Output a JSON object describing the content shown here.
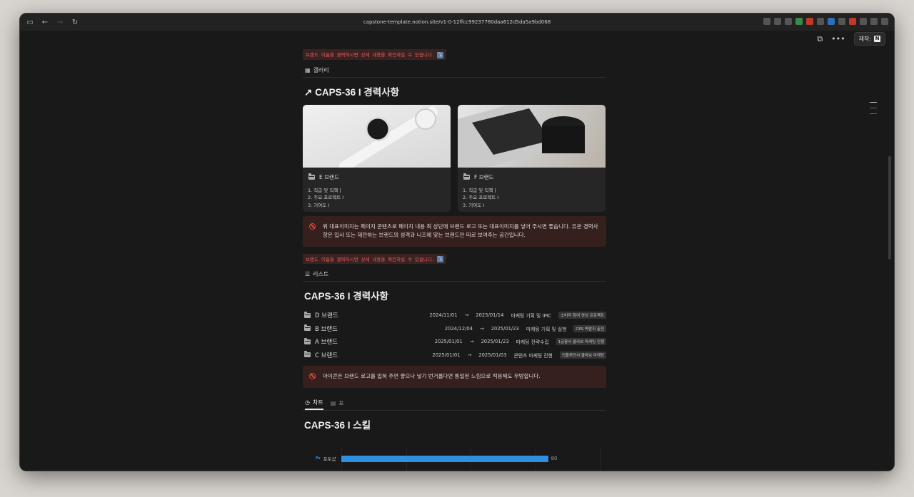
{
  "browser": {
    "url": "capstone-template.notion.site/v1-0-12ffcc99237780daa612d5da5a9bd068",
    "made_label": "제작:",
    "made_logo": "N"
  },
  "hint_text": "브랜드 이름을 클릭하시면 상세 내용을 확인하실 수 있습니다.",
  "hint_icon": "⤵",
  "gallery_section": {
    "tab_label": "갤러리",
    "title": "CAPS-36 I 경력사항",
    "title_icon": "↗",
    "cards": [
      {
        "title": "E 브랜드",
        "image": "watch",
        "lines": [
          "1. 직급 및 직책 |",
          "2. 주요 프로젝트 I",
          "3. 기여도 I"
        ]
      },
      {
        "title": "F 브랜드",
        "image": "laptop",
        "lines": [
          "1. 직급 및 직책 |",
          "2. 주요 프로젝트 I",
          "3. 기여도 I"
        ]
      }
    ],
    "callout": "위 대표이미지는 페이지 콘텐츠로 페이지 내용 최 상단에 브랜드 로고 또는 대표이미지를 넣어 주시면 좋습니다. 유관 경력사항은 입사 또는 제안하는 브랜드의 성격과 니즈에 맞는 브랜드만 따로 보여주는 공간입니다."
  },
  "list_section": {
    "tab_label": "리스트",
    "title": "CAPS-36 I 경력사항",
    "rows": [
      {
        "name": "D 브랜드",
        "start": "2024/11/01",
        "end": "2025/01/14",
        "role": "마케팅 기획 및 IMC",
        "tags": [
          "소비자 참여 영상 프로젝트"
        ]
      },
      {
        "name": "B 브랜드",
        "start": "2024/12/04",
        "end": "2025/01/23",
        "role": "마케팅 기획 및 실행",
        "tags": [
          "CES 박람회 출전"
        ]
      },
      {
        "name": "A 브랜드",
        "start": "2025/01/01",
        "end": "2025/01/23",
        "role": "마케팅 전략수립",
        "tags": [
          "1금융사 콜라보 마케팅 진행"
        ]
      },
      {
        "name": "C 브랜드",
        "start": "2025/01/01",
        "end": "2025/01/03",
        "role": "콘텐츠 마케팅 진행",
        "tags": [
          "인플루언서 콜라보 마케팅"
        ]
      }
    ],
    "arrow": "→",
    "callout": "아이콘은 브랜드 로고를 입혀 주면 좋으나 넣기 번거롭다면 통일된 느낌으로 적용해도 무방합니다."
  },
  "chart_section": {
    "tabs": [
      {
        "label": "차트",
        "active": true
      },
      {
        "label": "표",
        "active": false
      }
    ],
    "title": "CAPS-36 I 스킬"
  },
  "chart_data": {
    "type": "bar",
    "orientation": "horizontal",
    "categories": [
      "포토샵"
    ],
    "category_badges": [
      "Ps"
    ],
    "values": [
      80
    ],
    "xlim": [
      0,
      100
    ],
    "grid": true,
    "color": "#2f8fe0"
  },
  "colors": {
    "background": "#191919",
    "callout_bg": "#36201e",
    "hint_text": "#e0625a",
    "bar": "#2f8fe0"
  }
}
